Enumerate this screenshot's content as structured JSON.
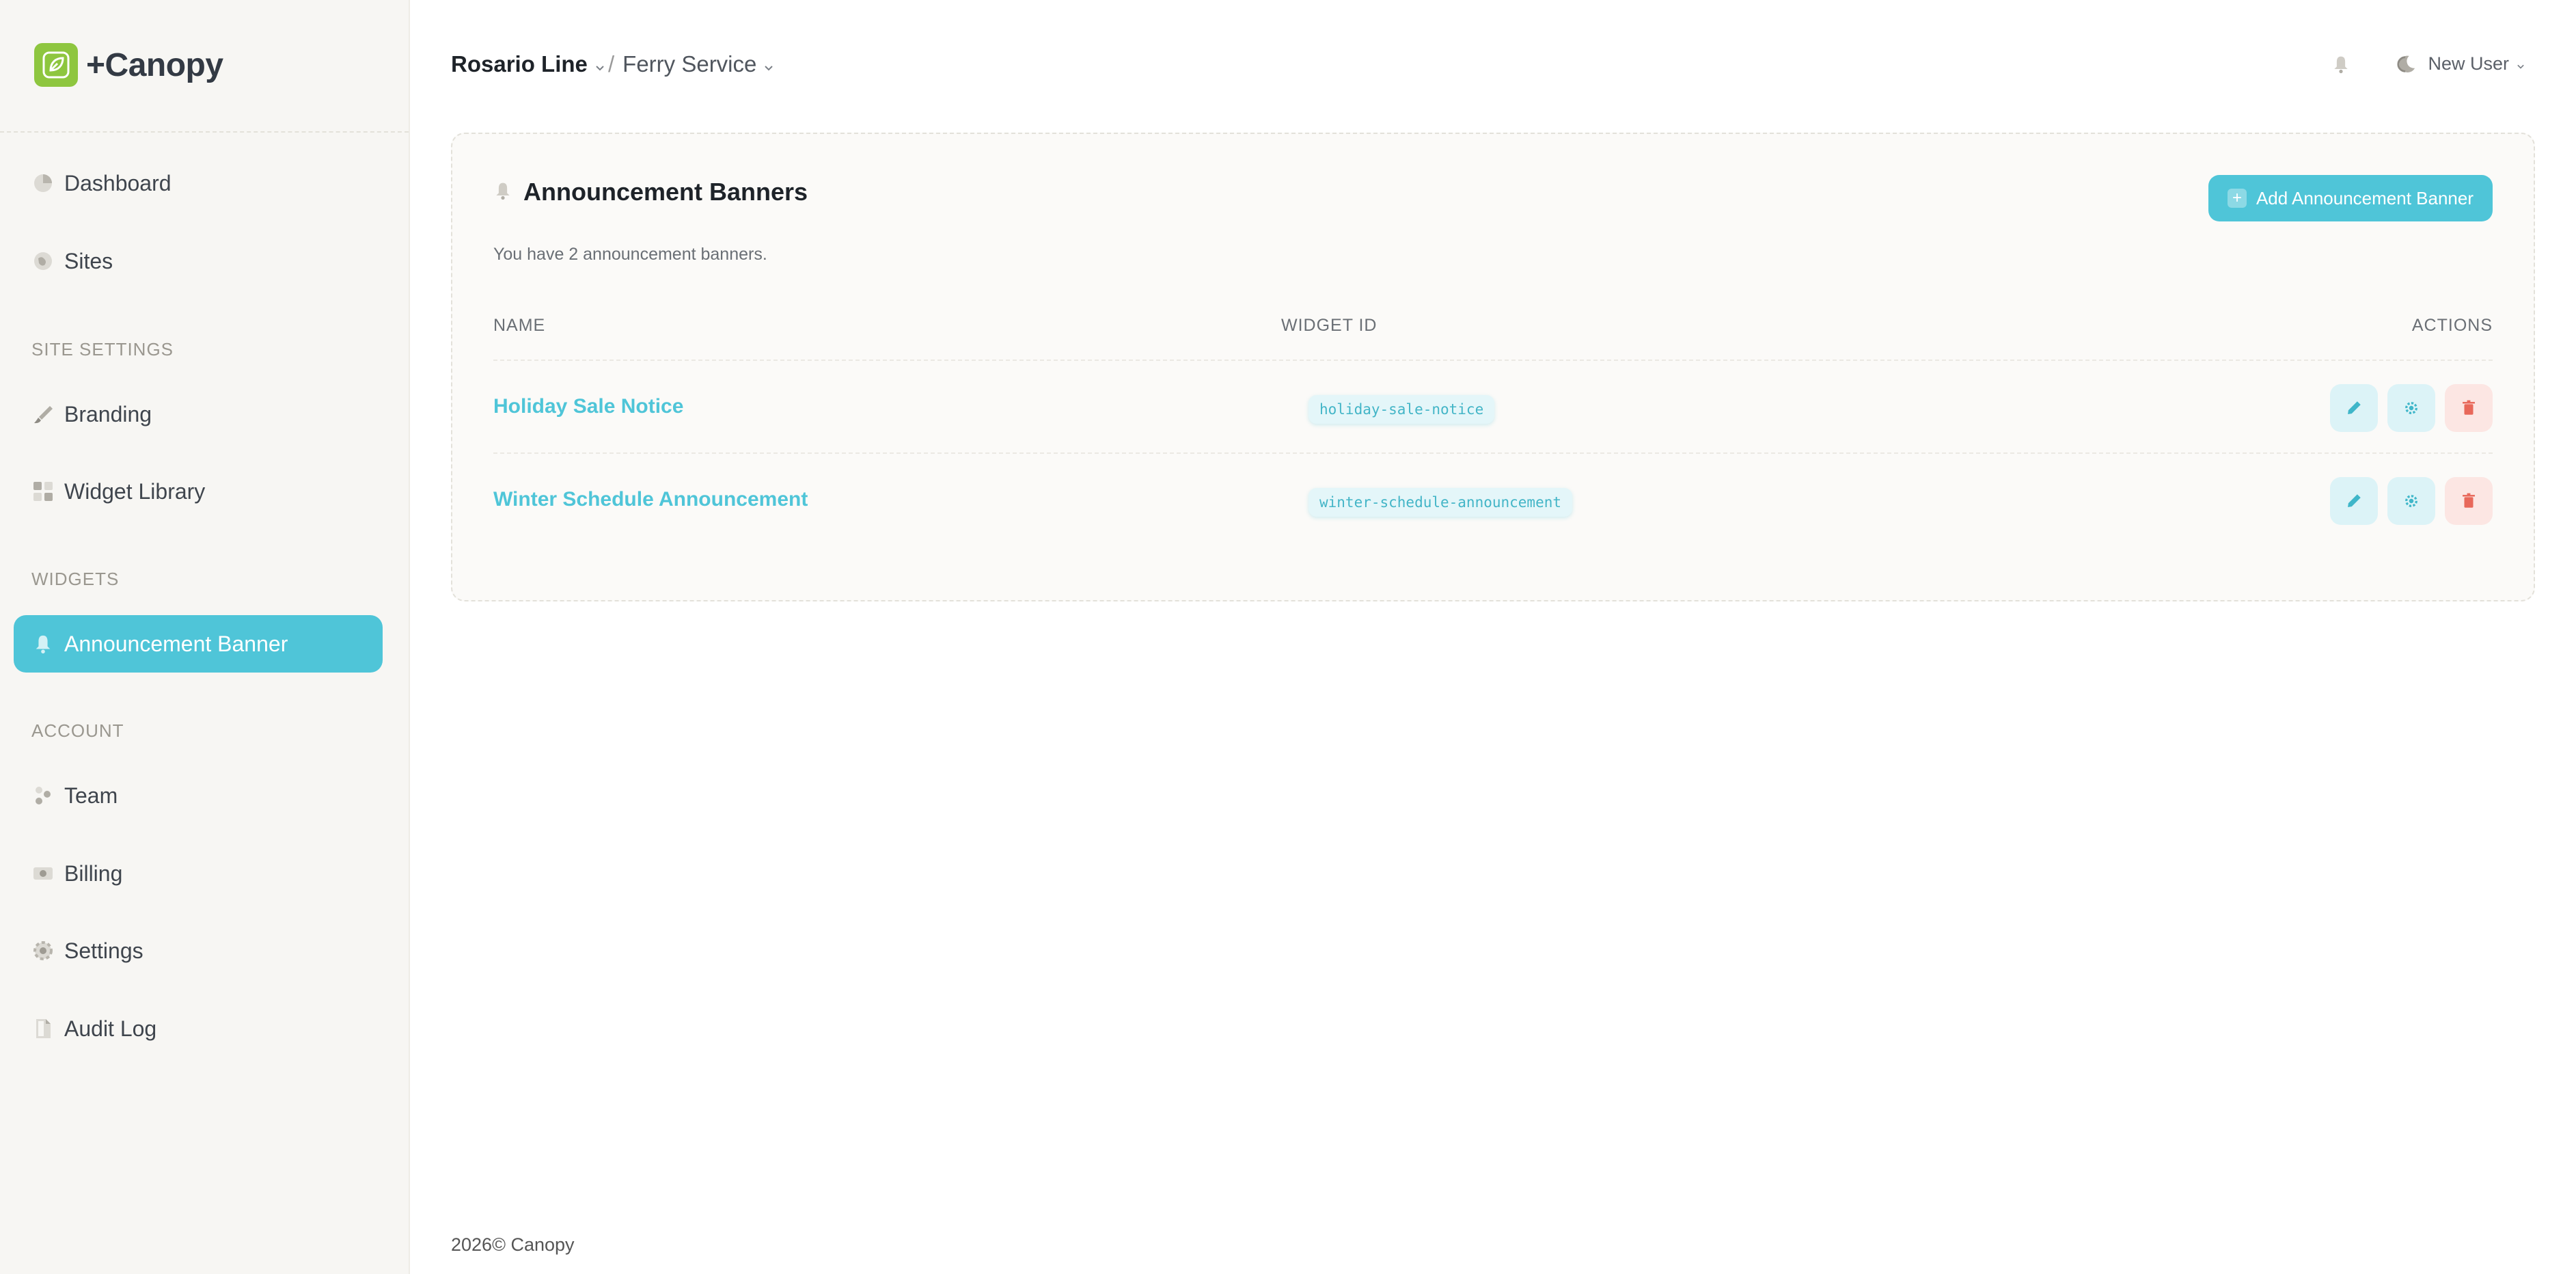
{
  "app": {
    "name": "+Canopy"
  },
  "sidebar": {
    "items_top": [
      {
        "label": "Dashboard",
        "icon": "pie-chart-icon"
      },
      {
        "label": "Sites",
        "icon": "globe-icon"
      }
    ],
    "site_settings_title": "SITE SETTINGS",
    "site_settings": [
      {
        "label": "Branding",
        "icon": "brush-icon"
      },
      {
        "label": "Widget Library",
        "icon": "grid-icon"
      }
    ],
    "widgets_title": "WIDGETS",
    "widgets": [
      {
        "label": "Announcement Banner",
        "icon": "bell-icon",
        "active": true
      }
    ],
    "account_title": "ACCOUNT",
    "account": [
      {
        "label": "Team",
        "icon": "team-icon"
      },
      {
        "label": "Billing",
        "icon": "billing-icon"
      },
      {
        "label": "Settings",
        "icon": "gear-icon"
      },
      {
        "label": "Audit Log",
        "icon": "document-icon"
      }
    ]
  },
  "header": {
    "org": "Rosario Line",
    "separator": "/",
    "site": "Ferry Service",
    "user": "New User"
  },
  "card": {
    "title": "Announcement Banners",
    "subtitle": "You have 2 announcement banners.",
    "add_button": "Add Announcement Banner",
    "columns": {
      "name": "NAME",
      "widget_id": "WIDGET ID",
      "actions": "ACTIONS"
    },
    "rows": [
      {
        "name": "Holiday Sale Notice",
        "widget_id": "holiday-sale-notice"
      },
      {
        "name": "Winter Schedule Announcement",
        "widget_id": "winter-schedule-announcement"
      }
    ]
  },
  "footer": {
    "year": "2026©",
    "brand": "Canopy"
  },
  "colors": {
    "accent": "#4fc5d8",
    "logo": "#8ec63f",
    "danger": "#e8685a"
  }
}
